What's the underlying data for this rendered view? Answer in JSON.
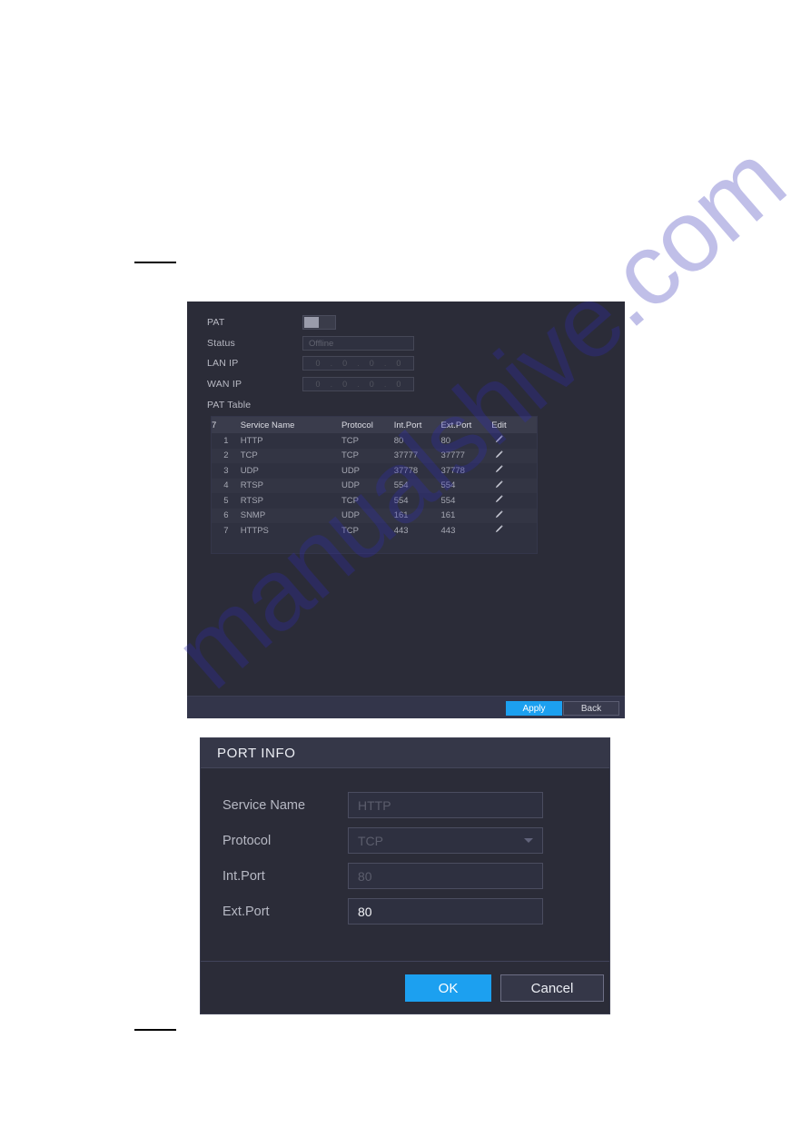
{
  "pat_panel": {
    "fields": [
      {
        "label": "PAT",
        "type": "toggle",
        "value": "off"
      },
      {
        "label": "Status",
        "type": "text",
        "value": "Offline"
      },
      {
        "label": "LAN IP",
        "type": "ip",
        "value": "0 . 0 . 0 . 0"
      },
      {
        "label": "WAN IP",
        "type": "ip",
        "value": "0 . 0 . 0 . 0"
      },
      {
        "label": "PAT Table",
        "type": "heading",
        "value": ""
      }
    ],
    "labels": {
      "pat": "PAT",
      "status": "Status",
      "lan_ip": "LAN IP",
      "wan_ip": "WAN IP",
      "pat_table": "PAT Table"
    },
    "values": {
      "status": "Offline",
      "lan_ip_octets": [
        "0",
        "0",
        "0",
        "0"
      ],
      "wan_ip_octets": [
        "0",
        "0",
        "0",
        "0"
      ]
    },
    "table": {
      "headers": [
        "7",
        "Service Name",
        "Protocol",
        "Int.Port",
        "Ext.Port",
        "Edit"
      ],
      "rows": [
        {
          "idx": "1",
          "service": "HTTP",
          "protocol": "TCP",
          "int_port": "80",
          "ext_port": "80",
          "edit": "edit-pencil-icon"
        },
        {
          "idx": "2",
          "service": "TCP",
          "protocol": "TCP",
          "int_port": "37777",
          "ext_port": "37777",
          "edit": "edit-pencil-icon"
        },
        {
          "idx": "3",
          "service": "UDP",
          "protocol": "UDP",
          "int_port": "37778",
          "ext_port": "37778",
          "edit": "edit-pencil-icon"
        },
        {
          "idx": "4",
          "service": "RTSP",
          "protocol": "UDP",
          "int_port": "554",
          "ext_port": "554",
          "edit": "edit-pencil-icon"
        },
        {
          "idx": "5",
          "service": "RTSP",
          "protocol": "TCP",
          "int_port": "554",
          "ext_port": "554",
          "edit": "edit-pencil-icon"
        },
        {
          "idx": "6",
          "service": "SNMP",
          "protocol": "UDP",
          "int_port": "161",
          "ext_port": "161",
          "edit": "edit-pencil-icon"
        },
        {
          "idx": "7",
          "service": "HTTPS",
          "protocol": "TCP",
          "int_port": "443",
          "ext_port": "443",
          "edit": "edit-pencil-icon"
        }
      ]
    },
    "footer": {
      "apply_label": "Apply",
      "back_label": "Back"
    }
  },
  "port_info_dialog": {
    "title": "PORT INFO",
    "fields": {
      "service_name_label": "Service Name",
      "service_name_value": "HTTP",
      "protocol_label": "Protocol",
      "protocol_value": "TCP",
      "int_port_label": "Int.Port",
      "int_port_value": "80",
      "ext_port_label": "Ext.Port",
      "ext_port_value": "80"
    },
    "footer": {
      "ok_label": "OK",
      "cancel_label": "Cancel"
    }
  },
  "watermark": {
    "text": "manualshive.com"
  },
  "colors": {
    "accent_blue": "#1ca0f0",
    "panel_bg": "#2b2c38",
    "table_header_bg": "#3a3c4c",
    "text_primary": "#eceef4",
    "text_muted": "#5b5d6c"
  }
}
